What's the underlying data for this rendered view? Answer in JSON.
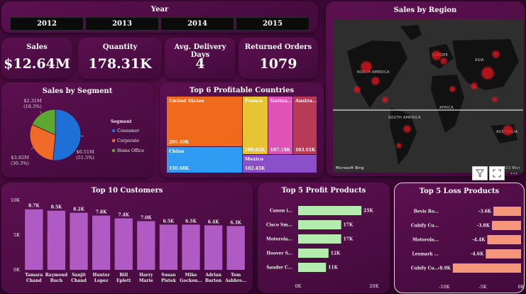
{
  "year_slicer": {
    "title": "Year",
    "options": [
      "2012",
      "2013",
      "2014",
      "2015"
    ]
  },
  "kpis": [
    {
      "label": "Sales",
      "value": "$12.64M"
    },
    {
      "label": "Quantity",
      "value": "178.31K"
    },
    {
      "label": "Avg. Delivery Days",
      "value": "4"
    },
    {
      "label": "Returned Orders",
      "value": "1079"
    }
  ],
  "map": {
    "title": "Sales by Region",
    "labels": [
      "NORTH AMERICA",
      "EUROPE",
      "ASIA",
      "AFRICA",
      "SOUTH AMERICA",
      "AUSTRALIA"
    ],
    "attribution": "Microsoft Bing",
    "copyright": "© 2023 Micr",
    "bubble_color": "#e6141e"
  },
  "toolbar": {
    "filter_icon": "filter-icon",
    "focus_icon": "focus-mode-icon",
    "more_label": "···"
  },
  "chart_data": [
    {
      "type": "pie",
      "title": "Sales by Segment",
      "legend_title": "Segment",
      "legend_position": "right",
      "categories": [
        "Consumer",
        "Corporate",
        "Home Office"
      ],
      "values": [
        6.51,
        3.82,
        2.31
      ],
      "percents": [
        "51.5%",
        "30.3%",
        "18.3%"
      ],
      "value_labels": [
        "$6.51M",
        "$3.82M",
        "$2.31M"
      ],
      "colors": [
        "#1e6fd6",
        "#f06a28",
        "#5aa832"
      ]
    },
    {
      "type": "treemap",
      "title": "Top 6 Profitable Countries",
      "categories": [
        "United States",
        "China",
        "France",
        "Germa...",
        "Austra...",
        "Mexico"
      ],
      "values_label": [
        "286.40K",
        "150.68K",
        "109.03K",
        "107.19K",
        "103.91K",
        "102.45K"
      ],
      "values": [
        286.4,
        150.68,
        109.03,
        107.19,
        103.91,
        102.45
      ],
      "colors": [
        "#f06a1c",
        "#2f9bf2",
        "#e8c435",
        "#e052b8",
        "#b83a57",
        "#8a4fc9"
      ]
    },
    {
      "type": "bar",
      "title": "Top 10 Customers",
      "categories": [
        "Tamara Chand",
        "Raymond Buch",
        "Sanjit Chand",
        "Hunter Lopez",
        "Bill Eplett",
        "Harry Marie",
        "Susan Pistek",
        "Mike Gockon...",
        "Adrian Barton",
        "Tom Ashbro..."
      ],
      "values": [
        8.7,
        8.5,
        8.2,
        7.8,
        7.4,
        7.0,
        6.5,
        6.5,
        6.4,
        6.3
      ],
      "data_labels": [
        "8.7K",
        "8.5K",
        "8.2K",
        "7.8K",
        "7.4K",
        "7.0K",
        "6.5K",
        "6.5K",
        "6.4K",
        "6.3K"
      ],
      "y_ticks": [
        "0K",
        "5K",
        "10K"
      ],
      "ylim": [
        0,
        10
      ],
      "color": "#b05ac4"
    },
    {
      "type": "bar",
      "orientation": "horizontal",
      "title": "Top 5 Profit Products",
      "categories": [
        "Canon i...",
        "Cisco Sm...",
        "Motorola...",
        "Hoover S...",
        "Sauder C..."
      ],
      "values": [
        25,
        17,
        17,
        12,
        11
      ],
      "data_labels": [
        "25K",
        "17K",
        "17K",
        "12K",
        "11K"
      ],
      "x_ticks": [
        "0K",
        "20K"
      ],
      "xlim": [
        0,
        30
      ],
      "color": "#b4ecb0"
    },
    {
      "type": "bar",
      "orientation": "horizontal",
      "title": "Top 5 Loss Products",
      "categories": [
        "Bevis Ro...",
        "Cubify Cu...",
        "Motorola...",
        "Lexmark ...",
        "Cubify Cu..."
      ],
      "values": [
        -3.6,
        -3.8,
        -4.4,
        -4.6,
        -8.9
      ],
      "data_labels": [
        "-3.6K",
        "-3.8K",
        "-4.4K",
        "-4.6K",
        "-8.9K"
      ],
      "x_ticks": [
        "-10K",
        "-5K",
        "0K"
      ],
      "xlim": [
        -10,
        0
      ],
      "color": "#f4967a"
    }
  ]
}
